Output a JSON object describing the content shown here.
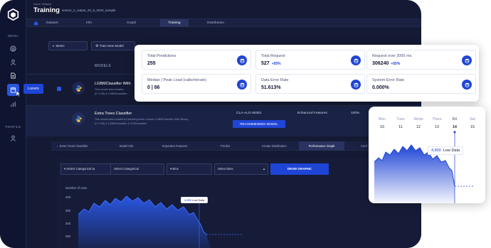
{
  "header": {
    "crumb_small": "Home / Network",
    "title": "Training",
    "path": "sensor_2_output_20_9_2023_sample"
  },
  "sidebar": {
    "menu_label": "MENU",
    "profile_label": "PROFILE",
    "tooltip": "Lorem"
  },
  "tabs": [
    "Dataset",
    "Info",
    "Graph",
    "Training",
    "Distribution"
  ],
  "filters": {
    "metric": "Metric",
    "train_new": "Train New Model"
  },
  "models": {
    "heading": "MODELS",
    "rows": [
      {
        "name": "LGBMClassifier With",
        "desc": "This model was created...",
        "desc2": "(0~0.95) & LGBMClassifier..."
      },
      {
        "name": "Extra Trees Classifier",
        "desc": "This model was created by blending three models LGBMClassifier With Binary",
        "desc2": "(0~0.95) & LGBMClassifier & XGBClassifier",
        "code": "CLA-ALG-55381",
        "features": "Enhanced Features",
        "pct": "100%"
      }
    ],
    "recommended_label": "RECOMMENDED MODEL"
  },
  "model_tabs": [
    "Extra Trees Classifier",
    "Model info",
    "Important Features",
    "Predict",
    "Create Distribution",
    "Performance Graph",
    "Conf"
  ],
  "graph_panel": {
    "sel1": "Select Categorical ta",
    "sel2": "Select Categorical",
    "sel3": "Bins",
    "sel4": "Select Bins",
    "draw_label": "DRAW GRAPHIC",
    "y_title": "Number of rows",
    "y_ticks": [
      "400",
      "350",
      "300",
      "250"
    ],
    "tooltip_value": "4,890",
    "tooltip_label": "Low Data"
  },
  "stats": [
    {
      "label": "Total Predictions",
      "value": "255",
      "delta": ""
    },
    {
      "label": "Total Request",
      "value": "527",
      "delta": "+55%"
    },
    {
      "label": "Request over 2000 ms",
      "value": "306240",
      "delta": "+55%"
    },
    {
      "label": "Median | Peak Load (calls/minute)",
      "value": "0 | 86",
      "delta": ""
    },
    {
      "label": "Data Error Rate",
      "value": "51.613%",
      "delta": ""
    },
    {
      "label": "System Error Rate",
      "value": "0.000%",
      "delta": ""
    }
  ],
  "week_card": {
    "days": [
      "Mon",
      "Tues",
      "Weds",
      "Thurs",
      "Fri",
      "Sat"
    ],
    "dates": [
      "10",
      "11",
      "12",
      "13",
      "14",
      "15"
    ],
    "selected_index": 4,
    "tooltip_value": "4,890",
    "tooltip_label": "Low Data"
  },
  "colors": {
    "accent": "#1f45d6",
    "dark_bg": "#141a33"
  }
}
